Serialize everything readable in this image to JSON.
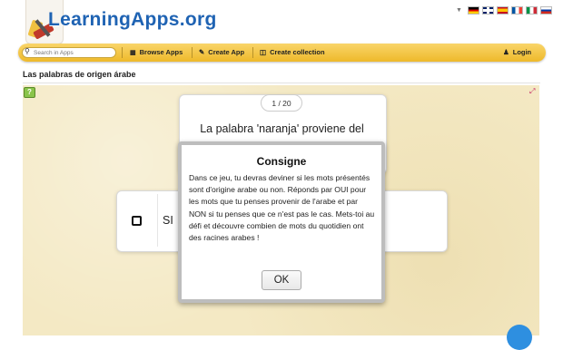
{
  "header": {
    "logo_text": "LearningApps.org",
    "flags": [
      "de",
      "gb",
      "es",
      "fr",
      "it",
      "ru"
    ]
  },
  "nav": {
    "search_placeholder": "Search in Apps",
    "browse_label": "Browse Apps",
    "create_label": "Create App",
    "collection_label": "Create collection",
    "login_label": "Login"
  },
  "page": {
    "title": "Las palabras de origen árabe"
  },
  "quiz": {
    "counter": "1 / 20",
    "question": "La palabra 'naranja' proviene del",
    "answer_label": "SI"
  },
  "modal": {
    "title": "Consigne",
    "body": "Dans ce jeu, tu devras deviner si les mots présentés sont d'origine arabe ou non. Réponds par OUI pour les mots que tu penses provenir de l'arabe et par NON si tu penses que ce n'est pas le cas. Mets-toi au défi et découvre combien de mots du quotidien ont des racines arabes !",
    "ok_label": "OK"
  },
  "colors": {
    "navbar": "#f0c040",
    "logo": "#1f63b3",
    "stage": "#f4e9c4",
    "accent_button": "#2e8fe0"
  }
}
